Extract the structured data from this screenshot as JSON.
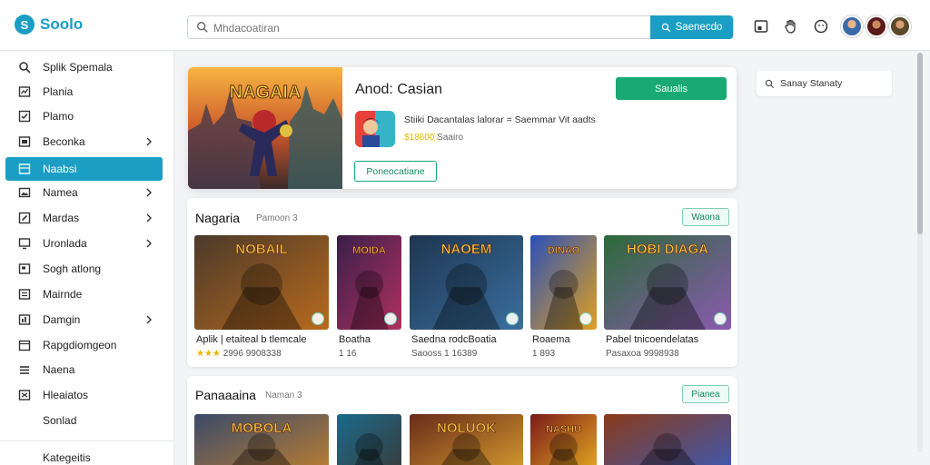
{
  "app": {
    "name": "Soolo"
  },
  "search": {
    "placeholder": "Mhdacoatiran",
    "button_label": "Saenecdo"
  },
  "sidebar": {
    "items": [
      {
        "label": "Splik Spemala",
        "icon": "search-icon",
        "chevron": false
      },
      {
        "label": "Plania",
        "icon": "chart-icon",
        "chevron": false
      },
      {
        "label": "Plamo",
        "icon": "check-icon",
        "chevron": false
      },
      {
        "label": "Beconka",
        "icon": "grid-icon",
        "chevron": true
      },
      {
        "label": "Naabsi",
        "icon": "table-icon",
        "chevron": false,
        "active": true
      },
      {
        "label": "Namea",
        "icon": "image-icon",
        "chevron": true
      },
      {
        "label": "Mardas",
        "icon": "edit-icon",
        "chevron": true
      },
      {
        "label": "Uronlada",
        "icon": "monitor-icon",
        "chevron": true
      },
      {
        "label": "Sogh atlong",
        "icon": "flag-icon",
        "chevron": false
      },
      {
        "label": "Mairnde",
        "icon": "list-icon",
        "chevron": false
      },
      {
        "label": "Damgin",
        "icon": "bar-icon",
        "chevron": true
      },
      {
        "label": "Rapgdiomgeon",
        "icon": "calendar-icon",
        "chevron": false
      },
      {
        "label": "Naena",
        "icon": "menu-icon",
        "chevron": false
      },
      {
        "label": "Hleaiatos",
        "icon": "box-icon",
        "chevron": false
      }
    ],
    "footer_label": "Sonlad",
    "bottom_label": "Kategeitis"
  },
  "featured": {
    "art_title": "NAGAIA",
    "title": "Anod: Casian",
    "cta_label": "Saualis",
    "description": "Stiiki Dacantalas lalorar = Saemmar Vit aadts",
    "price_gold": "$18600҉",
    "price_rest": "Saairo",
    "secondary_label": "Poneocatiane"
  },
  "right_panel": {
    "search_label": "Sanay Stanaty"
  },
  "sections": [
    {
      "title": "Nagaria",
      "subtitle": "Pamoon 3",
      "button_label": "Waona",
      "tiles": [
        {
          "art_text": "NOBAIL",
          "title": "Aplik | etaiteal b tlemcale",
          "rating": "★★★",
          "meta": "2996 9908338",
          "colors": [
            "#4a3a2a",
            "#b86a1e"
          ]
        },
        {
          "art_text": "MOIDA",
          "title": "Boatha",
          "rating": "",
          "meta": "1 16",
          "colors": [
            "#3a1f4a",
            "#b03060"
          ]
        },
        {
          "art_text": "NAOEM",
          "title": "Saedna rodcBoatia",
          "rating": "",
          "meta": "Saooss 1 16389",
          "colors": [
            "#1e3550",
            "#3a6f9e"
          ]
        },
        {
          "art_text": "DINAO",
          "title": "Roaema",
          "rating": "",
          "meta": "1 893",
          "colors": [
            "#2a50b8",
            "#e0a020"
          ]
        },
        {
          "art_text": "HOBI DIAGA",
          "title": "Pabel tnicoendelatas",
          "rating": "",
          "meta": "Pasaxoa 9998938",
          "colors": [
            "#2c6a3a",
            "#8a5ab0"
          ]
        }
      ]
    },
    {
      "title": "Panaaaina",
      "subtitle": "Naman 3",
      "button_label": "Pianea",
      "tiles": [
        {
          "art_text": "MOBOLA",
          "colors": [
            "#3a4a6a",
            "#c08030"
          ]
        },
        {
          "art_text": "",
          "colors": [
            "#1a6a8a",
            "#3a3a3a"
          ]
        },
        {
          "art_text": "NOLUOK",
          "colors": [
            "#6a2a1a",
            "#d8a030"
          ]
        },
        {
          "art_text": "NASHU",
          "colors": [
            "#7a1a1a",
            "#e8b020"
          ]
        },
        {
          "art_text": "",
          "colors": [
            "#8a3a1a",
            "#3a5ab8"
          ]
        }
      ]
    }
  ],
  "colors": {
    "accent": "#1b9ec4",
    "cta_green": "#19a974",
    "star_gold": "#e6b800"
  }
}
